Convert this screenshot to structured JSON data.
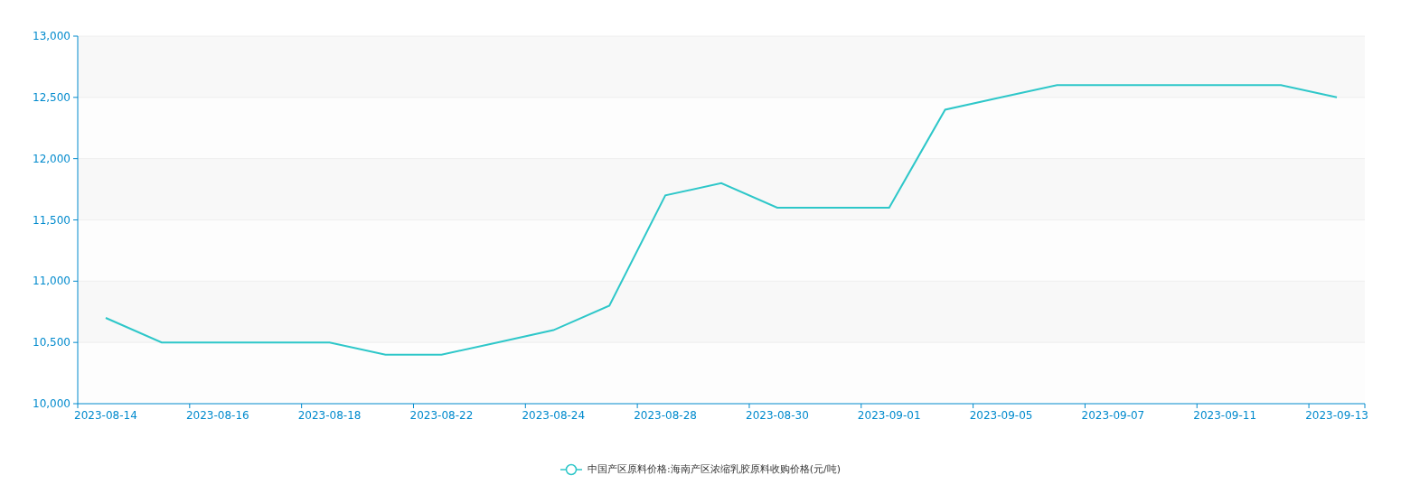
{
  "chart": {
    "chart_data": {
      "type": "line",
      "categories": [
        "2023-08-14",
        null,
        "2023-08-16",
        null,
        "2023-08-18",
        null,
        "2023-08-22",
        null,
        "2023-08-24",
        null,
        "2023-08-28",
        null,
        "2023-08-30",
        null,
        "2023-09-01",
        null,
        "2023-09-05",
        null,
        "2023-09-07",
        null,
        "2023-09-11",
        null,
        "2023-09-13"
      ],
      "grid": true,
      "ylim": [
        10000,
        13000
      ],
      "yticks": [
        {
          "value": 10000,
          "label": "10,000"
        },
        {
          "value": 10500,
          "label": "10,500"
        },
        {
          "value": 11000,
          "label": "11,000"
        },
        {
          "value": 11500,
          "label": "11,500"
        },
        {
          "value": 12000,
          "label": "12,000"
        },
        {
          "value": 12500,
          "label": "12,500"
        },
        {
          "value": 13000,
          "label": "13,000"
        }
      ],
      "series": [
        {
          "name": "中国产区原料价格:海南产区浓缩乳胶原料收购价格(元/吨)",
          "color": "#2ec7c9",
          "values": [
            10700,
            10500,
            10500,
            10500,
            10500,
            10400,
            10400,
            10500,
            10600,
            10800,
            11700,
            11800,
            11600,
            11600,
            11600,
            12400,
            12500,
            12600,
            12600,
            12600,
            12600,
            12600,
            12500
          ]
        }
      ]
    }
  }
}
